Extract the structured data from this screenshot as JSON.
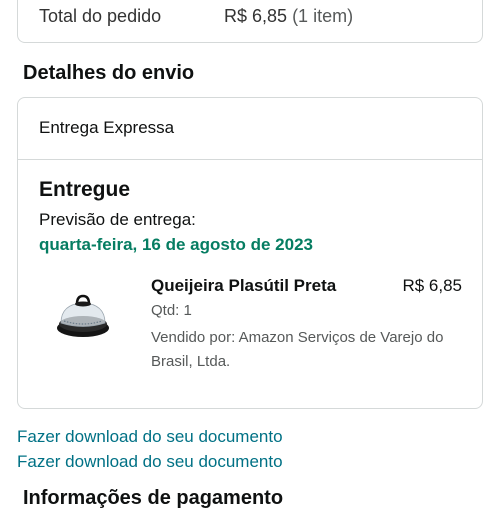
{
  "order_summary": {
    "total_label": "Total do pedido",
    "total_value": "R$ 6,85",
    "total_items": "(1 item)"
  },
  "shipping": {
    "section_title": "Detalhes do envio",
    "method": "Entrega Expressa",
    "status": "Entregue",
    "eta_label": "Previsão de entrega:",
    "eta_date": "quarta-feira, 16 de agosto de 2023",
    "item": {
      "name": "Queijeira Plasútil Preta",
      "price": "R$ 6,85",
      "qty": "Qtd: 1",
      "seller": "Vendido por: Amazon Serviços de Varejo do Brasil, Ltda.",
      "image_icon": "cheese-dish-product-image"
    }
  },
  "links": [
    "Fazer download do seu documento",
    "Fazer download do seu documento"
  ],
  "next_section_title": "Informações de pagamento",
  "colors": {
    "link": "#007185",
    "delivered_date": "#067d62",
    "border": "#d5d9d9"
  }
}
